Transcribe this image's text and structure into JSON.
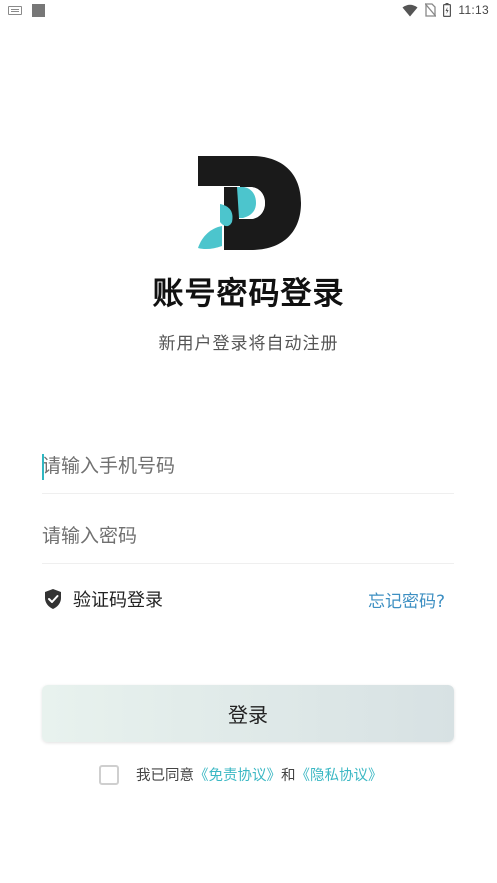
{
  "status_bar": {
    "time": "11:13",
    "icons": [
      "keyboard-icon",
      "square-icon",
      "wifi-icon",
      "no-sim-icon",
      "battery-icon"
    ]
  },
  "brand": {
    "logo_colors": {
      "dark": "#1a1a1a",
      "accent": "#4cc5cd"
    }
  },
  "header": {
    "title": "账号密码登录",
    "subtitle": "新用户登录将自动注册"
  },
  "form": {
    "phone": {
      "placeholder": "请输入手机号码",
      "value": ""
    },
    "password": {
      "placeholder": "请输入密码",
      "value": ""
    },
    "verify_code_login": "验证码登录",
    "forgot_password": "忘记密码?"
  },
  "login_button": "登录",
  "agreement": {
    "prefix": "我已同意",
    "terms_link": "《免责协议》",
    "and": "和",
    "privacy_link": "《隐私协议》",
    "checked": false
  },
  "colors": {
    "accent": "#3cb8c4",
    "link_blue": "#3d8fc2",
    "button_bg_start": "#e8f2ee",
    "button_bg_end": "#d7e1e3"
  }
}
